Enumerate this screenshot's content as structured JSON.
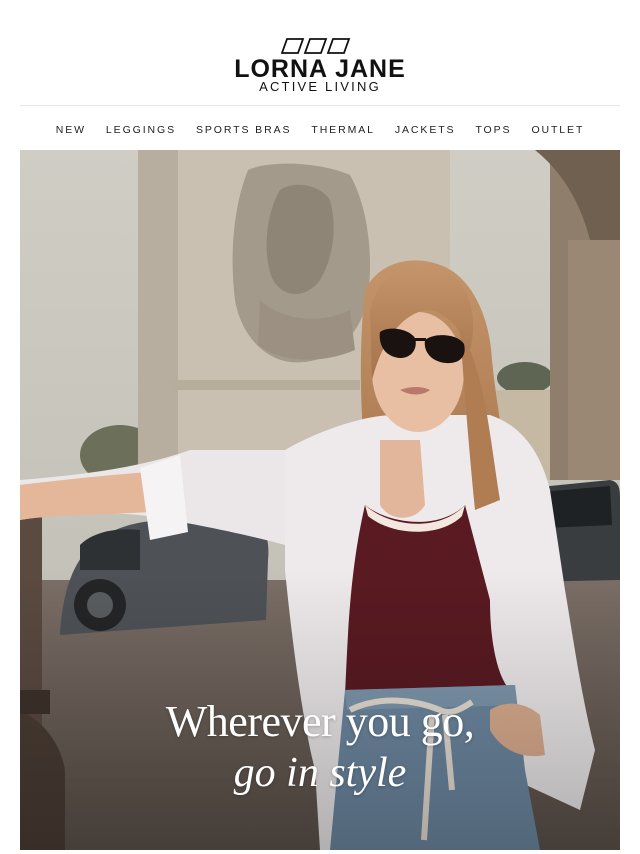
{
  "brand": {
    "name": "LORNA JANE",
    "tagline": "ACTIVE LIVING"
  },
  "nav": {
    "items": [
      "NEW",
      "LEGGINGS",
      "SPORTS BRAS",
      "THERMAL",
      "JACKETS",
      "TOPS",
      "OUTLET"
    ]
  },
  "hero": {
    "headline_line1": "Wherever you go,",
    "headline_line2": "go in style",
    "image_subject": "woman-in-white-shirt-and-sunglasses-paris-arch"
  },
  "colors": {
    "text": "#111111",
    "divider": "#e6e6e6",
    "headline": "#ffffff"
  }
}
